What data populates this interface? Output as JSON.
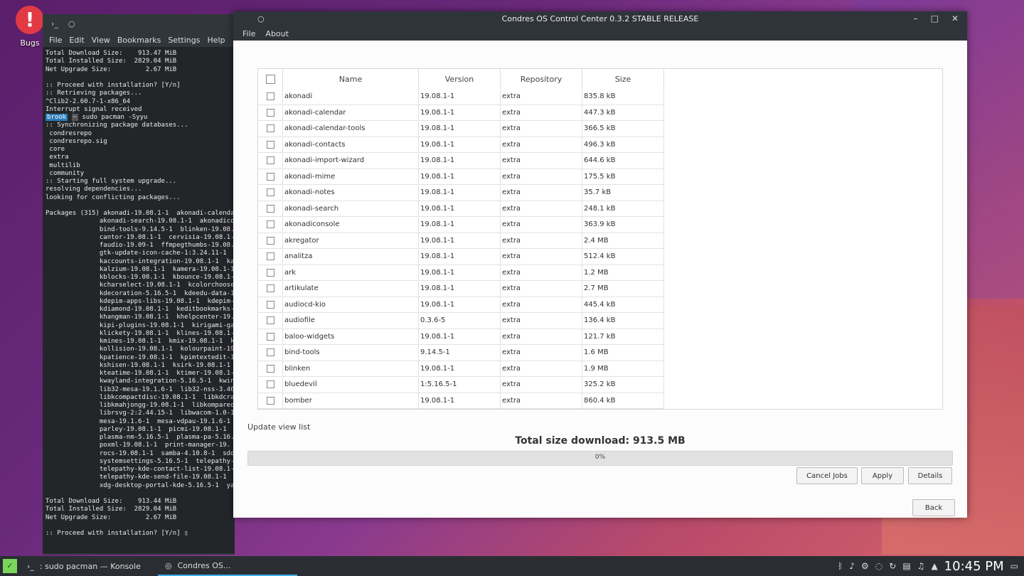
{
  "desktop": {
    "icon_label": "Bugs"
  },
  "konsole": {
    "menu": [
      "File",
      "Edit",
      "View",
      "Bookmarks",
      "Settings",
      "Help"
    ],
    "lines_top": [
      "Total Download Size:    913.47 MiB",
      "Total Installed Size:  2829.04 MiB",
      "Net Upgrade Size:         2.67 MiB",
      "",
      ":: Proceed with installation? [Y/n]",
      ":: Retrieving packages...",
      "^Clib2-2.60.7-1-x86_64",
      "Interrupt signal received",
      ""
    ],
    "prompt_user": "brook",
    "prompt_dir": "~",
    "command": " sudo pacman -Syyu",
    "lines_bottom": [
      ":: Synchronizing package databases...",
      " condresrepo",
      " condresrepo.sig",
      " core",
      " extra",
      " multilib",
      " community",
      ":: Starting full system upgrade...",
      "resolving dependencies...",
      "looking for conflicting packages...",
      "",
      "Packages (315) akonadi-19.08.1-1  akonadi-calendar",
      "              akonadi-search-19.08.1-1  akonadicon",
      "              bind-tools-9.14.5-1  blinken-19.08.",
      "              cantor-19.08.1-1  cervisia-19.08.1-",
      "              faudio-19.09-1  ffmpegthumbs-19.08.",
      "              gtk-update-icon-cache-1:3.24.11-1",
      "              kaccounts-integration-19.08.1-1  ka",
      "              kalzium-19.08.1-1  kamera-19.08.1-1",
      "              kblocks-19.08.1-1  kbounce-19.08.1-",
      "              kcharselect-19.08.1-1  kcolorchoose",
      "              kdecoration-5.16.5-1  kdeedu-data-1",
      "              kdepim-apps-libs-19.08.1-1  kdepim-",
      "              kdiamond-19.08.1-1  keditbookmarks-",
      "              khangman-19.08.1-1  khelpcenter-19.",
      "              kipi-plugins-19.08.1-1  kirigami-ga",
      "              klickety-19.08.1-1  klines-19.08.1-",
      "              kmines-19.08.1-1  kmix-19.08.1-1  k",
      "              kollision-19.08.1-1  kolourpaint-19",
      "              kpatience-19.08.1-1  kpimtextedit-1",
      "              kshisen-19.08.1-1  ksirk-19.08.1-1",
      "              kteatime-19.08.1-1  ktimer-19.08.1-",
      "              kwayland-integration-5.16.5-1  kwin",
      "              lib32-mesa-19.1.6-1  lib32-nss-3.46",
      "              libkcompactdisc-19.08.1-1  libkdcra",
      "              libkmahjongg-19.08.1-1  libkompared",
      "              librsvg-2:2.44.15-1  libwacom-1.0-1",
      "              mesa-19.1.6-1  mesa-vdpau-19.1.6-1",
      "              parley-19.08.1-1  picmi-19.08.1-1",
      "              plasma-nm-5.16.5-1  plasma-pa-5.16.",
      "              poxml-19.08.1-1  print-manager-19.",
      "              rocs-19.08.1-1  samba-4.10.8-1  sdd",
      "              systemsettings-5.16.5-1  telepathy-",
      "              telepathy-kde-contact-list-19.08.1-",
      "              telepathy-kde-send-file-19.08.1-1",
      "              xdg-desktop-portal-kde-5.16.5-1  ya",
      "",
      "Total Download Size:    913.44 MiB",
      "Total Installed Size:  2829.04 MiB",
      "Net Upgrade Size:         2.67 MiB",
      "",
      ":: Proceed with installation? [Y/n] ▯"
    ]
  },
  "control_center": {
    "title": "Condres OS Control Center 0.3.2 STABLE RELEASE",
    "menu": [
      "File",
      "About"
    ],
    "columns": [
      "Name",
      "Version",
      "Repository",
      "Size"
    ],
    "rows": [
      [
        "akonadi",
        "19.08.1-1",
        "extra",
        "835.8 kB"
      ],
      [
        "akonadi-calendar",
        "19.08.1-1",
        "extra",
        "447.3 kB"
      ],
      [
        "akonadi-calendar-tools",
        "19.08.1-1",
        "extra",
        "366.5 kB"
      ],
      [
        "akonadi-contacts",
        "19.08.1-1",
        "extra",
        "496.3 kB"
      ],
      [
        "akonadi-import-wizard",
        "19.08.1-1",
        "extra",
        "644.6 kB"
      ],
      [
        "akonadi-mime",
        "19.08.1-1",
        "extra",
        "175.5 kB"
      ],
      [
        "akonadi-notes",
        "19.08.1-1",
        "extra",
        "35.7 kB"
      ],
      [
        "akonadi-search",
        "19.08.1-1",
        "extra",
        "248.1 kB"
      ],
      [
        "akonadiconsole",
        "19.08.1-1",
        "extra",
        "363.9 kB"
      ],
      [
        "akregator",
        "19.08.1-1",
        "extra",
        "2.4 MB"
      ],
      [
        "analitza",
        "19.08.1-1",
        "extra",
        "512.4 kB"
      ],
      [
        "ark",
        "19.08.1-1",
        "extra",
        "1.2 MB"
      ],
      [
        "artikulate",
        "19.08.1-1",
        "extra",
        "2.7 MB"
      ],
      [
        "audiocd-kio",
        "19.08.1-1",
        "extra",
        "445.4 kB"
      ],
      [
        "audiofile",
        "0.3.6-5",
        "extra",
        "136.4 kB"
      ],
      [
        "baloo-widgets",
        "19.08.1-1",
        "extra",
        "121.7 kB"
      ],
      [
        "bind-tools",
        "9.14.5-1",
        "extra",
        "1.6 MB"
      ],
      [
        "blinken",
        "19.08.1-1",
        "extra",
        "1.9 MB"
      ],
      [
        "bluedevil",
        "1:5.16.5-1",
        "extra",
        "325.2 kB"
      ],
      [
        "bomber",
        "19.08.1-1",
        "extra",
        "860.4 kB"
      ]
    ],
    "update_view_label": "Update view list",
    "total_label": "Total size download: 913.5 MB",
    "progress_percent": 0,
    "progress_label": "0%",
    "buttons": {
      "cancel": "Cancel Jobs",
      "apply": "Apply",
      "details": "Details",
      "back": "Back"
    }
  },
  "taskbar": {
    "tasks": [
      ": sudo pacman — Konsole",
      "Condres OS..."
    ],
    "clock": "10:45 PM"
  },
  "colors": {
    "accent": "#3daee9",
    "bugs_red": "#e23a44"
  }
}
